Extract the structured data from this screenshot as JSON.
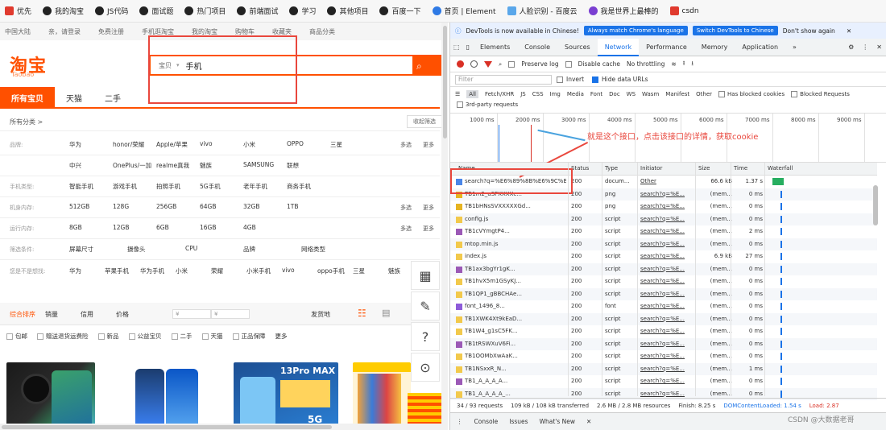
{
  "bookmarks": [
    {
      "label": "优先",
      "icon": "bookmark-red-icon"
    },
    {
      "label": "我的淘宝",
      "icon": "github-icon"
    },
    {
      "label": "JS代码",
      "icon": "github-icon"
    },
    {
      "label": "面试题",
      "icon": "github-icon"
    },
    {
      "label": "热门项目",
      "icon": "github-icon"
    },
    {
      "label": "前端面试",
      "icon": "github-icon"
    },
    {
      "label": "学习",
      "icon": "github-icon"
    },
    {
      "label": "其他项目",
      "icon": "github-icon"
    },
    {
      "label": "百度一下",
      "icon": "github-icon"
    },
    {
      "label": "首页 | Element",
      "icon": "element-icon"
    },
    {
      "label": "人脸识别 - 百度云",
      "icon": "cloud-icon"
    },
    {
      "label": "我是世界上最棒的",
      "icon": "purple-icon"
    },
    {
      "label": "csdn",
      "icon": "csdn-icon"
    }
  ],
  "taobao": {
    "topbar": [
      "中国大陆",
      "亲，请登录",
      "免费注册",
      "手机逛淘宝",
      "我的淘宝",
      "购物车",
      "收藏夹",
      "商品分类"
    ],
    "logo": "淘宝",
    "logo_sub": "Taobao",
    "search": {
      "type": "宝贝",
      "value": "手机"
    },
    "tabs": [
      "所有宝贝",
      "天猫",
      "二手"
    ],
    "crumb": "所有分类 >",
    "crumb_btn": "收起筛选",
    "filters": [
      {
        "label": "品牌:",
        "values": [
          "华为",
          "honor/荣耀",
          "Apple/苹果",
          "vivo",
          "小米",
          "OPPO",
          "三星"
        ],
        "more": [
          "多选",
          "更多"
        ]
      },
      {
        "label": "",
        "values": [
          "中兴",
          "OnePlus/一加",
          "realme真我",
          "魅族",
          "SAMSUNG",
          "联想"
        ],
        "more": []
      },
      {
        "label": "手机类型:",
        "values": [
          "智能手机",
          "游戏手机",
          "拍照手机",
          "5G手机",
          "老年手机",
          "商务手机"
        ],
        "more": []
      },
      {
        "label": "机身内存:",
        "values": [
          "512GB",
          "128G",
          "256GB",
          "64GB",
          "32GB",
          "1TB"
        ],
        "more": [
          "多选",
          "更多"
        ]
      },
      {
        "label": "运行内存:",
        "values": [
          "8GB",
          "12GB",
          "6GB",
          "16GB",
          "4GB"
        ],
        "more": [
          "多选",
          "更多"
        ]
      },
      {
        "label": "筛选条件:",
        "values": [
          "屏幕尺寸",
          "摄像头",
          "CPU",
          "品牌",
          "网络类型"
        ],
        "more": []
      }
    ],
    "related": {
      "label": "您是不是想找:",
      "values": [
        "华为",
        "苹果手机",
        "华为手机",
        "小米",
        "荣耀",
        "小米手机",
        "vivo",
        "oppo手机",
        "三星",
        "魅族"
      ]
    },
    "sort": [
      "综合排序",
      "销量",
      "信用",
      "价格",
      "¥",
      "¥"
    ],
    "sort_right": "发货地",
    "checks": [
      "包邮",
      "赠送退货运费险",
      "新品",
      "公益宝贝",
      "二手",
      "天猫",
      "正品保障",
      "更多"
    ],
    "tools": [
      "grid-icon",
      "edit-icon",
      "?",
      "clock-icon"
    ]
  },
  "devtools": {
    "info_text": "DevTools is now available in Chinese!",
    "info_btn1": "Always match Chrome's language",
    "info_btn2": "Switch DevTools to Chinese",
    "info_btn3": "Don't show again",
    "tabs": [
      "Elements",
      "Console",
      "Sources",
      "Network",
      "Performance",
      "Memory",
      "Application",
      "»"
    ],
    "toolbar": {
      "preserve": "Preserve log",
      "disable_cache": "Disable cache",
      "throttle": "No throttling"
    },
    "filter_placeholder": "Filter",
    "invert": "Invert",
    "hide_urls": "Hide data URLs",
    "types": [
      "All",
      "Fetch/XHR",
      "JS",
      "CSS",
      "Img",
      "Media",
      "Font",
      "Doc",
      "WS",
      "Wasm",
      "Manifest",
      "Other"
    ],
    "blocked_cookies": "Has blocked cookies",
    "blocked_requests": "Blocked Requests",
    "third_party": "3rd-party requests",
    "overview_ticks": [
      "1000 ms",
      "2000 ms",
      "3000 ms",
      "4000 ms",
      "5000 ms",
      "6000 ms",
      "7000 ms",
      "8000 ms",
      "9000 ms"
    ],
    "annotation": "就是这个接口，点击该接口的详情，获取cookie",
    "headers": [
      "Name",
      "Status",
      "Type",
      "Initiator",
      "Size",
      "Time",
      "Waterfall"
    ],
    "rows": [
      {
        "name": "search?q=%E6%89%8B%E6%9C%BA...",
        "status": "200",
        "type": "docum...",
        "init": "Other",
        "size": "66.6 kB",
        "time": "1.37 s"
      },
      {
        "name": "TB1m2_uSFXXXXc...",
        "status": "200",
        "type": "png",
        "init": "search?q=%E...",
        "size": "(mem...",
        "time": "0 ms"
      },
      {
        "name": "TB1bHNsSVXXXXXGd...",
        "status": "200",
        "type": "png",
        "init": "search?q=%E...",
        "size": "(mem...",
        "time": "0 ms"
      },
      {
        "name": "config.js",
        "status": "200",
        "type": "script",
        "init": "search?q=%E...",
        "size": "(mem...",
        "time": "0 ms"
      },
      {
        "name": "TB1cVYmgtP4...",
        "status": "200",
        "type": "script",
        "init": "search?q=%E...",
        "size": "(mem...",
        "time": "2 ms"
      },
      {
        "name": "mtop.min.js",
        "status": "200",
        "type": "script",
        "init": "search?q=%E...",
        "size": "(mem...",
        "time": "0 ms"
      },
      {
        "name": "index.js",
        "status": "200",
        "type": "script",
        "init": "search?q=%E...",
        "size": "6.9 kB",
        "time": "27 ms"
      },
      {
        "name": "TB1ax3bgYr1gK...",
        "status": "200",
        "type": "script",
        "init": "search?q=%E...",
        "size": "(mem...",
        "time": "0 ms"
      },
      {
        "name": "TB1hvX5m1GSyKJ...",
        "status": "200",
        "type": "script",
        "init": "search?q=%E...",
        "size": "(mem...",
        "time": "0 ms"
      },
      {
        "name": "TB1QP1_gBBCHAe...",
        "status": "200",
        "type": "script",
        "init": "search?q=%E...",
        "size": "(mem...",
        "time": "0 ms"
      },
      {
        "name": "font_1496_8...",
        "status": "200",
        "type": "font",
        "init": "search?q=%E...",
        "size": "(mem...",
        "time": "0 ms"
      },
      {
        "name": "TB1XWK4Xt9kEaD...",
        "status": "200",
        "type": "script",
        "init": "search?q=%E...",
        "size": "(mem...",
        "time": "0 ms"
      },
      {
        "name": "TB1W4_g1sC5FK...",
        "status": "200",
        "type": "script",
        "init": "search?q=%E...",
        "size": "(mem...",
        "time": "0 ms"
      },
      {
        "name": "TB1tRSWXuV6Fi...",
        "status": "200",
        "type": "script",
        "init": "search?q=%E...",
        "size": "(mem...",
        "time": "0 ms"
      },
      {
        "name": "TB1OOMbXwAaK...",
        "status": "200",
        "type": "script",
        "init": "search?q=%E...",
        "size": "(mem...",
        "time": "0 ms"
      },
      {
        "name": "TB1NSxxR_N...",
        "status": "200",
        "type": "script",
        "init": "search?q=%E...",
        "size": "(mem...",
        "time": "1 ms"
      },
      {
        "name": "TB1_A_A_A_A...",
        "status": "200",
        "type": "script",
        "init": "search?q=%E...",
        "size": "(mem...",
        "time": "0 ms"
      },
      {
        "name": "TB1_A_A_A_A_...",
        "status": "200",
        "type": "script",
        "init": "search?q=%E...",
        "size": "(mem...",
        "time": "0 ms"
      }
    ],
    "status": {
      "requests": "34 / 93 requests",
      "transferred": "109 kB / 108 kB transferred",
      "resources": "2.6 MB / 2.8 MB resources",
      "finish": "Finish: 8.25 s",
      "dcl": "DOMContentLoaded: 1.54 s",
      "load": "Load: 2.87"
    },
    "drawer": [
      "Console",
      "Issues",
      "What's New"
    ]
  },
  "watermark": "CSDN @大数据老哥"
}
